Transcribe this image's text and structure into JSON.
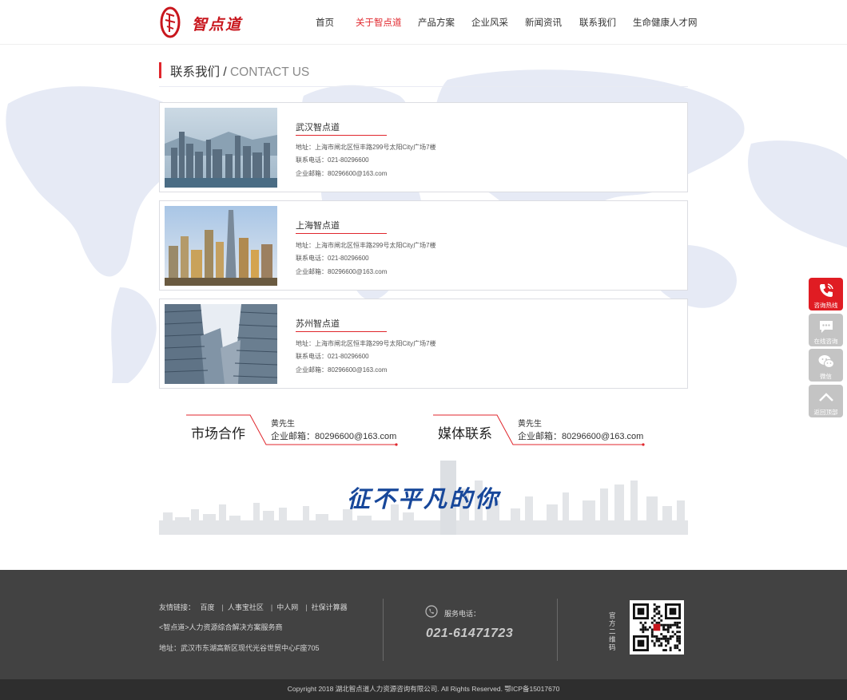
{
  "header": {
    "brand": "智点道",
    "nav": [
      {
        "label": "首页",
        "active": false
      },
      {
        "label": "关于智点道",
        "active": true
      },
      {
        "label": "产品方案",
        "active": false
      },
      {
        "label": "企业风采",
        "active": false
      },
      {
        "label": "新闻资讯",
        "active": false
      },
      {
        "label": "联系我们",
        "active": false
      },
      {
        "label": "生命健康人才网",
        "active": false
      }
    ]
  },
  "section": {
    "title_cn": "联系我们",
    "separator": " / ",
    "title_en": "CONTACT US"
  },
  "offices": [
    {
      "name": "武汉智点道",
      "address": "地址：上海市闸北区恒丰路299号太阳City广场7楼",
      "phone": "联系电话：021-80296600",
      "email": "企业邮箱：80296600@163.com",
      "photo": "hong-kong-skyline"
    },
    {
      "name": "上海智点道",
      "address": "地址：上海市闸北区恒丰路299号太阳City广场7楼",
      "phone": "联系电话：021-80296600",
      "email": "企业邮箱：80296600@163.com",
      "photo": "shanghai-skyline"
    },
    {
      "name": "苏州智点道",
      "address": "地址：上海市闸北区恒丰路299号太阳City广场7楼",
      "phone": "联系电话：021-80296600",
      "email": "企业邮箱：80296600@163.com",
      "photo": "skyscrapers-upward"
    }
  ],
  "contacts": [
    {
      "label": "市场合作",
      "person": "黄先生",
      "email": "企业邮箱：80296600@163.com"
    },
    {
      "label": "媒体联系",
      "person": "黄先生",
      "email": "企业邮箱：80296600@163.com"
    }
  ],
  "banner": {
    "slogan": "征不平凡的你"
  },
  "footer": {
    "links_label": "友情链接：",
    "links": [
      "百度",
      "人事宝社区",
      "中人网",
      "社保计算器"
    ],
    "slogan": "<智点道>人力资源综合解决方案服务商",
    "address": "地址：武汉市东湖高新区现代光谷世贸中心F座705",
    "phone_label": "服务电话：",
    "phone": "021-61471723",
    "qr_label": "官方二维码",
    "copyright": "Copyright 2018 湖北智点道人力资源咨询有限公司. All Rights Reserved. 鄂ICP备15017670"
  },
  "sidebar": [
    {
      "label": "咨询热线",
      "icon": "phone-icon"
    },
    {
      "label": "在线咨询",
      "icon": "chat-icon"
    },
    {
      "label": "微信",
      "icon": "wechat-icon"
    },
    {
      "label": "返回顶部",
      "icon": "chevron-up-icon"
    }
  ],
  "colors": {
    "accent": "#e0262c",
    "footer": "#424242",
    "slogan": "#17479a"
  }
}
